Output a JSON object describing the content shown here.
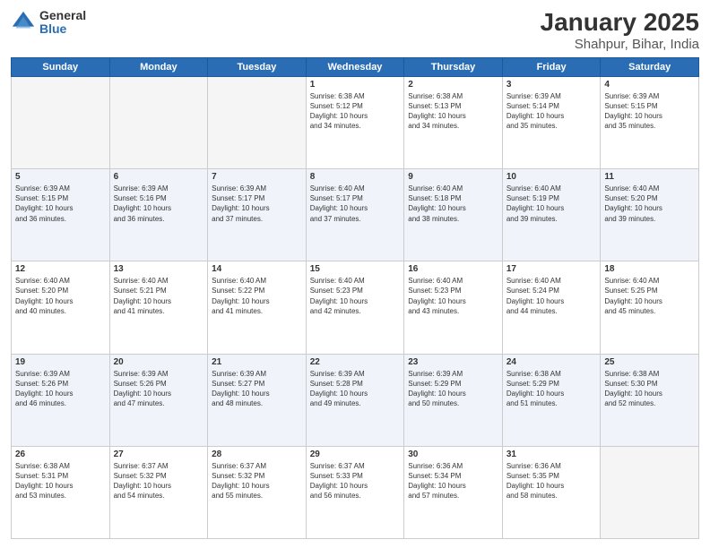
{
  "logo": {
    "general": "General",
    "blue": "Blue"
  },
  "title": "January 2025",
  "subtitle": "Shahpur, Bihar, India",
  "days_header": [
    "Sunday",
    "Monday",
    "Tuesday",
    "Wednesday",
    "Thursday",
    "Friday",
    "Saturday"
  ],
  "weeks": [
    [
      {
        "day": "",
        "info": ""
      },
      {
        "day": "",
        "info": ""
      },
      {
        "day": "",
        "info": ""
      },
      {
        "day": "1",
        "info": "Sunrise: 6:38 AM\nSunset: 5:12 PM\nDaylight: 10 hours\nand 34 minutes."
      },
      {
        "day": "2",
        "info": "Sunrise: 6:38 AM\nSunset: 5:13 PM\nDaylight: 10 hours\nand 34 minutes."
      },
      {
        "day": "3",
        "info": "Sunrise: 6:39 AM\nSunset: 5:14 PM\nDaylight: 10 hours\nand 35 minutes."
      },
      {
        "day": "4",
        "info": "Sunrise: 6:39 AM\nSunset: 5:15 PM\nDaylight: 10 hours\nand 35 minutes."
      }
    ],
    [
      {
        "day": "5",
        "info": "Sunrise: 6:39 AM\nSunset: 5:15 PM\nDaylight: 10 hours\nand 36 minutes."
      },
      {
        "day": "6",
        "info": "Sunrise: 6:39 AM\nSunset: 5:16 PM\nDaylight: 10 hours\nand 36 minutes."
      },
      {
        "day": "7",
        "info": "Sunrise: 6:39 AM\nSunset: 5:17 PM\nDaylight: 10 hours\nand 37 minutes."
      },
      {
        "day": "8",
        "info": "Sunrise: 6:40 AM\nSunset: 5:17 PM\nDaylight: 10 hours\nand 37 minutes."
      },
      {
        "day": "9",
        "info": "Sunrise: 6:40 AM\nSunset: 5:18 PM\nDaylight: 10 hours\nand 38 minutes."
      },
      {
        "day": "10",
        "info": "Sunrise: 6:40 AM\nSunset: 5:19 PM\nDaylight: 10 hours\nand 39 minutes."
      },
      {
        "day": "11",
        "info": "Sunrise: 6:40 AM\nSunset: 5:20 PM\nDaylight: 10 hours\nand 39 minutes."
      }
    ],
    [
      {
        "day": "12",
        "info": "Sunrise: 6:40 AM\nSunset: 5:20 PM\nDaylight: 10 hours\nand 40 minutes."
      },
      {
        "day": "13",
        "info": "Sunrise: 6:40 AM\nSunset: 5:21 PM\nDaylight: 10 hours\nand 41 minutes."
      },
      {
        "day": "14",
        "info": "Sunrise: 6:40 AM\nSunset: 5:22 PM\nDaylight: 10 hours\nand 41 minutes."
      },
      {
        "day": "15",
        "info": "Sunrise: 6:40 AM\nSunset: 5:23 PM\nDaylight: 10 hours\nand 42 minutes."
      },
      {
        "day": "16",
        "info": "Sunrise: 6:40 AM\nSunset: 5:23 PM\nDaylight: 10 hours\nand 43 minutes."
      },
      {
        "day": "17",
        "info": "Sunrise: 6:40 AM\nSunset: 5:24 PM\nDaylight: 10 hours\nand 44 minutes."
      },
      {
        "day": "18",
        "info": "Sunrise: 6:40 AM\nSunset: 5:25 PM\nDaylight: 10 hours\nand 45 minutes."
      }
    ],
    [
      {
        "day": "19",
        "info": "Sunrise: 6:39 AM\nSunset: 5:26 PM\nDaylight: 10 hours\nand 46 minutes."
      },
      {
        "day": "20",
        "info": "Sunrise: 6:39 AM\nSunset: 5:26 PM\nDaylight: 10 hours\nand 47 minutes."
      },
      {
        "day": "21",
        "info": "Sunrise: 6:39 AM\nSunset: 5:27 PM\nDaylight: 10 hours\nand 48 minutes."
      },
      {
        "day": "22",
        "info": "Sunrise: 6:39 AM\nSunset: 5:28 PM\nDaylight: 10 hours\nand 49 minutes."
      },
      {
        "day": "23",
        "info": "Sunrise: 6:39 AM\nSunset: 5:29 PM\nDaylight: 10 hours\nand 50 minutes."
      },
      {
        "day": "24",
        "info": "Sunrise: 6:38 AM\nSunset: 5:29 PM\nDaylight: 10 hours\nand 51 minutes."
      },
      {
        "day": "25",
        "info": "Sunrise: 6:38 AM\nSunset: 5:30 PM\nDaylight: 10 hours\nand 52 minutes."
      }
    ],
    [
      {
        "day": "26",
        "info": "Sunrise: 6:38 AM\nSunset: 5:31 PM\nDaylight: 10 hours\nand 53 minutes."
      },
      {
        "day": "27",
        "info": "Sunrise: 6:37 AM\nSunset: 5:32 PM\nDaylight: 10 hours\nand 54 minutes."
      },
      {
        "day": "28",
        "info": "Sunrise: 6:37 AM\nSunset: 5:32 PM\nDaylight: 10 hours\nand 55 minutes."
      },
      {
        "day": "29",
        "info": "Sunrise: 6:37 AM\nSunset: 5:33 PM\nDaylight: 10 hours\nand 56 minutes."
      },
      {
        "day": "30",
        "info": "Sunrise: 6:36 AM\nSunset: 5:34 PM\nDaylight: 10 hours\nand 57 minutes."
      },
      {
        "day": "31",
        "info": "Sunrise: 6:36 AM\nSunset: 5:35 PM\nDaylight: 10 hours\nand 58 minutes."
      },
      {
        "day": "",
        "info": ""
      }
    ]
  ]
}
